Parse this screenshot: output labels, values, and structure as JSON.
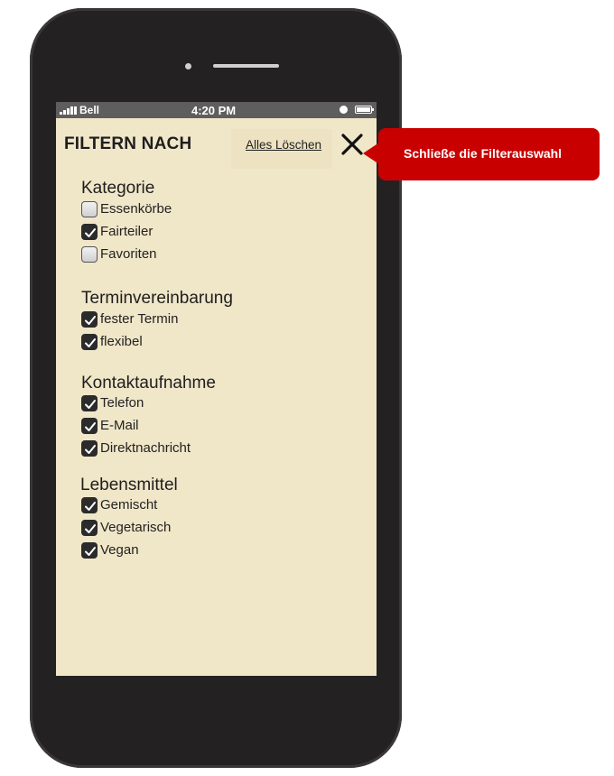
{
  "statusbar": {
    "carrier": "Bell",
    "time": "4:20 PM",
    "alarm_icon": "alarm-icon",
    "battery_icon": "battery-icon"
  },
  "header": {
    "title": "FILTERN NACH",
    "clear_all": "Alles Löschen",
    "close_icon": "close-icon"
  },
  "groups": [
    {
      "title": "Kategorie",
      "options": [
        {
          "label": "Essenkörbe",
          "checked": false
        },
        {
          "label": "Fairteiler",
          "checked": true
        },
        {
          "label": "Favoriten",
          "checked": false
        }
      ]
    },
    {
      "title": "Terminvereinbarung",
      "options": [
        {
          "label": "fester Termin",
          "checked": true
        },
        {
          "label": "flexibel",
          "checked": true
        }
      ]
    },
    {
      "title": "Kontaktaufnahme",
      "options": [
        {
          "label": "Telefon",
          "checked": true
        },
        {
          "label": "E-Mail",
          "checked": true
        },
        {
          "label": "Direktnachricht",
          "checked": true
        }
      ]
    },
    {
      "title": "Lebensmittel",
      "options": [
        {
          "label": "Gemischt",
          "checked": true
        },
        {
          "label": "Vegetarisch",
          "checked": true
        },
        {
          "label": "Vegan",
          "checked": true
        }
      ]
    }
  ],
  "callout": {
    "text": "Schließe die Filterauswahl",
    "color": "#c90000"
  },
  "colors": {
    "screen_bg": "#f0e6c8",
    "phone_body": "#242122",
    "statusbar_bg": "#5e5e5e"
  }
}
